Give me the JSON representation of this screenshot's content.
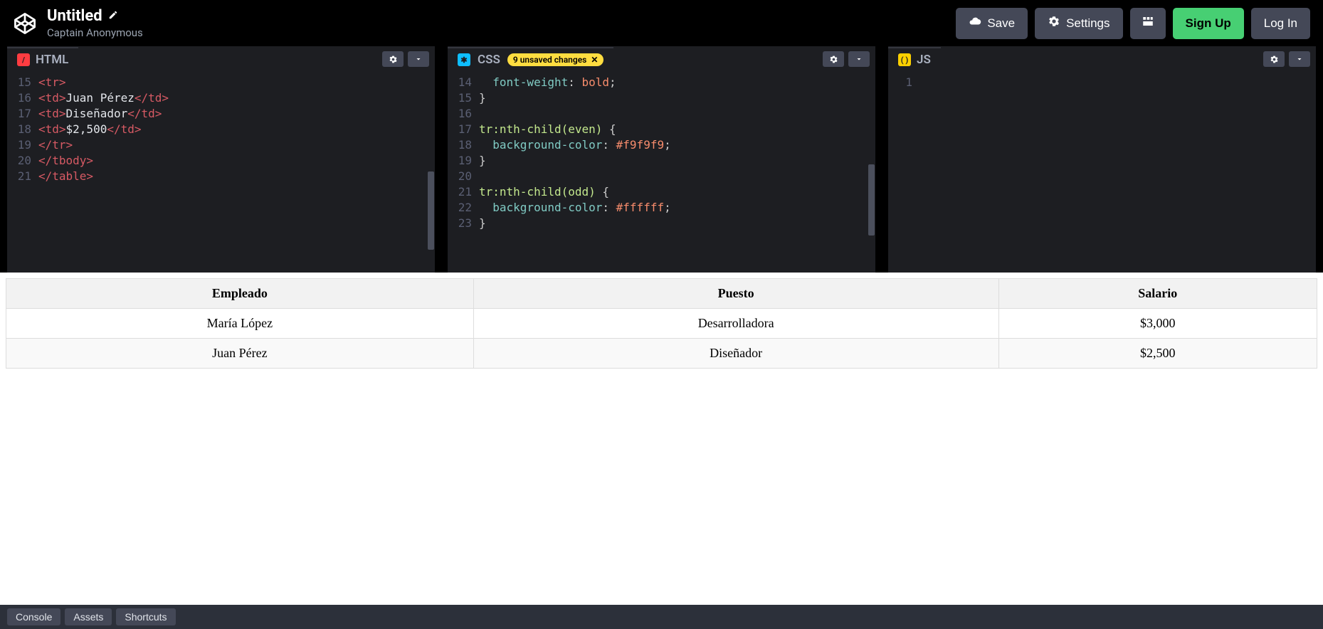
{
  "header": {
    "title": "Untitled",
    "author": "Captain Anonymous",
    "buttons": {
      "save": "Save",
      "settings": "Settings",
      "signup": "Sign Up",
      "login": "Log In"
    }
  },
  "editors": {
    "html": {
      "label": "HTML",
      "lines": [
        {
          "n": 15,
          "tokens": [
            {
              "t": "<tr>",
              "c": "tag"
            }
          ]
        },
        {
          "n": 16,
          "tokens": [
            {
              "t": "<td>",
              "c": "tag"
            },
            {
              "t": "Juan Pérez",
              "c": "text"
            },
            {
              "t": "</td>",
              "c": "tag"
            }
          ]
        },
        {
          "n": 17,
          "tokens": [
            {
              "t": "<td>",
              "c": "tag"
            },
            {
              "t": "Diseñador",
              "c": "text"
            },
            {
              "t": "</td>",
              "c": "tag"
            }
          ]
        },
        {
          "n": 18,
          "tokens": [
            {
              "t": "<td>",
              "c": "tag"
            },
            {
              "t": "$2,500",
              "c": "text"
            },
            {
              "t": "</td>",
              "c": "tag"
            }
          ]
        },
        {
          "n": 19,
          "tokens": [
            {
              "t": "</tr>",
              "c": "tag"
            }
          ]
        },
        {
          "n": 20,
          "tokens": [
            {
              "t": "</tbody>",
              "c": "tag"
            }
          ]
        },
        {
          "n": 21,
          "tokens": [
            {
              "t": "</table>",
              "c": "tag"
            }
          ]
        }
      ]
    },
    "css": {
      "label": "CSS",
      "unsaved": "9 unsaved changes",
      "lines": [
        {
          "n": 14,
          "tokens": [
            {
              "t": "  font-weight",
              "c": "prop"
            },
            {
              "t": ": ",
              "c": "punc"
            },
            {
              "t": "bold",
              "c": "val"
            },
            {
              "t": ";",
              "c": "punc"
            }
          ]
        },
        {
          "n": 15,
          "tokens": [
            {
              "t": "}",
              "c": "punc"
            }
          ]
        },
        {
          "n": 16,
          "tokens": []
        },
        {
          "n": 17,
          "tokens": [
            {
              "t": "tr:nth-child(even)",
              "c": "sel"
            },
            {
              "t": " {",
              "c": "punc"
            }
          ]
        },
        {
          "n": 18,
          "tokens": [
            {
              "t": "  background-color",
              "c": "prop"
            },
            {
              "t": ": ",
              "c": "punc"
            },
            {
              "t": "#f9f9f9",
              "c": "val"
            },
            {
              "t": ";",
              "c": "punc"
            }
          ]
        },
        {
          "n": 19,
          "tokens": [
            {
              "t": "}",
              "c": "punc"
            }
          ]
        },
        {
          "n": 20,
          "tokens": []
        },
        {
          "n": 21,
          "tokens": [
            {
              "t": "tr:nth-child(odd)",
              "c": "sel"
            },
            {
              "t": " {",
              "c": "punc"
            }
          ]
        },
        {
          "n": 22,
          "tokens": [
            {
              "t": "  background-color",
              "c": "prop"
            },
            {
              "t": ": ",
              "c": "punc"
            },
            {
              "t": "#ffffff",
              "c": "val"
            },
            {
              "t": ";",
              "c": "punc"
            }
          ]
        },
        {
          "n": 23,
          "tokens": [
            {
              "t": "}",
              "c": "punc"
            }
          ]
        }
      ]
    },
    "js": {
      "label": "JS",
      "lines": [
        {
          "n": 1,
          "tokens": []
        }
      ]
    }
  },
  "preview_table": {
    "headers": [
      "Empleado",
      "Puesto",
      "Salario"
    ],
    "rows": [
      [
        "María López",
        "Desarrolladora",
        "$3,000"
      ],
      [
        "Juan Pérez",
        "Diseñador",
        "$2,500"
      ]
    ]
  },
  "footer": {
    "console": "Console",
    "assets": "Assets",
    "shortcuts": "Shortcuts"
  }
}
